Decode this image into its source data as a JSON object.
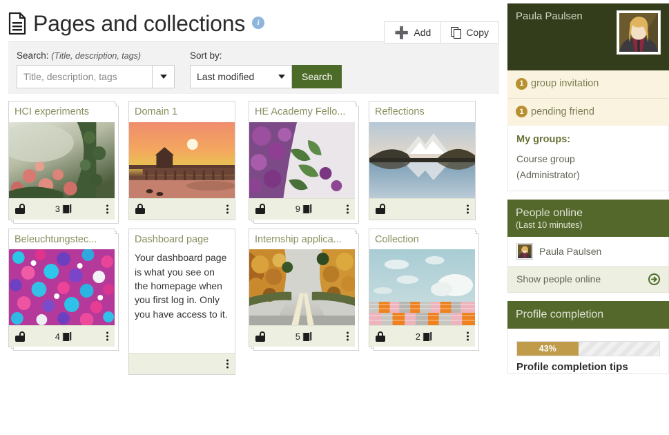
{
  "header": {
    "title": "Pages and collections",
    "page_icon": "document-icon",
    "info_icon": "info-icon"
  },
  "toolbar": {
    "add_label": "Add",
    "add_icon": "plus-icon",
    "copy_label": "Copy",
    "copy_icon": "copy-icon"
  },
  "search": {
    "label": "Search:",
    "label_hint": "(Title, description, tags)",
    "placeholder": "Title, description, tags",
    "value": "",
    "sort_label": "Sort by:",
    "sort_value": "Last modified",
    "button_label": "Search",
    "button_color": "#4c6b29",
    "dropdown_icon": "chevron-down-icon"
  },
  "cards": [
    {
      "title": "HCI experiments",
      "type": "image",
      "thumb": "flowers-meadow",
      "lock": "unlocked",
      "count": "3",
      "stacked": true,
      "menu_icon": "kebab-menu-icon"
    },
    {
      "title": "Domain 1",
      "type": "image",
      "thumb": "sunset-pier",
      "lock": "locked",
      "count": "",
      "stacked": false,
      "menu_icon": "kebab-menu-icon"
    },
    {
      "title": "HE Academy Fello...",
      "type": "image",
      "thumb": "purple-lilac",
      "lock": "unlocked",
      "count": "9",
      "stacked": true,
      "menu_icon": "kebab-menu-icon"
    },
    {
      "title": "Reflections",
      "type": "image",
      "thumb": "mountain-lake",
      "lock": "unlocked",
      "count": "",
      "stacked": false,
      "menu_icon": "kebab-menu-icon"
    },
    {
      "title": "Beleuchtungstec...",
      "type": "image",
      "thumb": "sprinkles",
      "lock": "unlocked",
      "count": "4",
      "stacked": true,
      "menu_icon": "kebab-menu-icon"
    },
    {
      "title": "Dashboard page",
      "type": "text",
      "body": "Your dashboard page is what you see on the homepage when you first log in. Only you have access to it.",
      "lock": "none",
      "count": "",
      "stacked": false,
      "menu_icon": "kebab-menu-icon"
    },
    {
      "title": "Internship applica...",
      "type": "image",
      "thumb": "autumn-road",
      "lock": "unlocked",
      "count": "5",
      "stacked": true,
      "menu_icon": "kebab-menu-icon"
    },
    {
      "title": "Collection",
      "type": "image",
      "thumb": "clouds-pipes",
      "lock": "locked",
      "count": "2",
      "stacked": true,
      "menu_icon": "kebab-menu-icon"
    }
  ],
  "sidebar": {
    "user": {
      "name": "Paula Paulsen",
      "avatar": "user-avatar"
    },
    "notifications": [
      {
        "count": "1",
        "label": "group invitation"
      },
      {
        "count": "1",
        "label": "pending friend"
      }
    ],
    "groups": {
      "title": "My groups:",
      "name": "Course group",
      "role": "(Administrator)"
    },
    "people_online": {
      "title": "People online",
      "subtitle": "(Last 10 minutes)",
      "person": "Paula Paulsen",
      "link_label": "Show people online",
      "link_icon": "arrow-right-circle-icon"
    },
    "profile_completion": {
      "title": "Profile completion",
      "percent_label": "43%",
      "percent_value": 43,
      "tips_label": "Profile completion tips",
      "bar_color": "#bf9b4a"
    }
  }
}
